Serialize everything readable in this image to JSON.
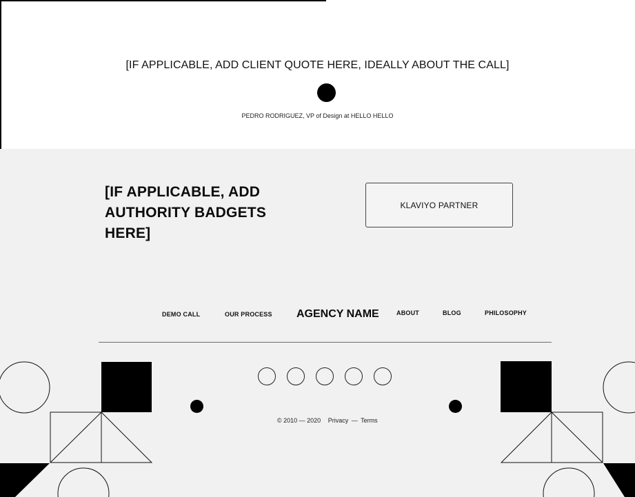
{
  "quote": {
    "text": "[IF APPLICABLE, ADD CLIENT QUOTE HERE, IDEALLY ABOUT THE CALL]",
    "author": "PEDRO RODRIGUEZ, VP of Design at HELLO HELLO"
  },
  "authority": {
    "heading": "[IF APPLICABLE, ADD AUTHORITY BADGETS HERE]",
    "badge_label": "KLAVIYO PARTNER"
  },
  "footer_nav": {
    "demo_call": "DEMO CALL",
    "our_process": "OUR PROCESS",
    "agency_name": "AGENCY NAME",
    "about": "ABOUT",
    "blog": "BLOG",
    "philosophy": "PHILOSOPHY"
  },
  "social_icons": [
    "social-link-1",
    "social-link-2",
    "social-link-3",
    "social-link-4",
    "social-link-5"
  ],
  "copyright": {
    "text": "© 2010 — 2020",
    "privacy": "Privacy",
    "separator": "—",
    "terms": "Terms"
  },
  "colors": {
    "background_top": "#ffffff",
    "background_footer": "#f1f1f1",
    "ink": "#000000"
  }
}
